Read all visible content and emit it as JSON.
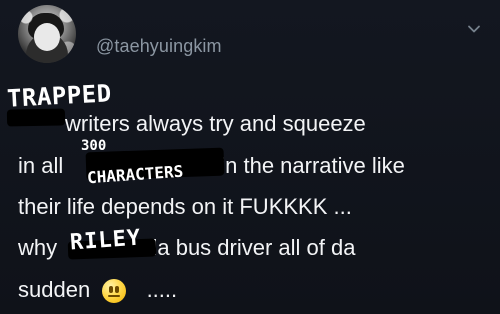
{
  "header": {
    "handle": "@taehyuingkim",
    "menu_icon": "chevron-down-icon"
  },
  "tweet": {
    "line1_text": "writers always try and squeeze",
    "line2_prefix": "in all",
    "line2_suffix": "in the narrative like",
    "line3_text": "their life depends on it FUKKKK ...",
    "line4_prefix": "why",
    "line4_suffix": "da bus driver all of da",
    "line5_text": "sudden",
    "line5_suffix": ".....",
    "emoji_name": "neutral-face-icon"
  },
  "handwriting": {
    "trapped": "TRAPPED",
    "number": "300",
    "characters": "CHARACTERS",
    "riley": "RILEY"
  }
}
